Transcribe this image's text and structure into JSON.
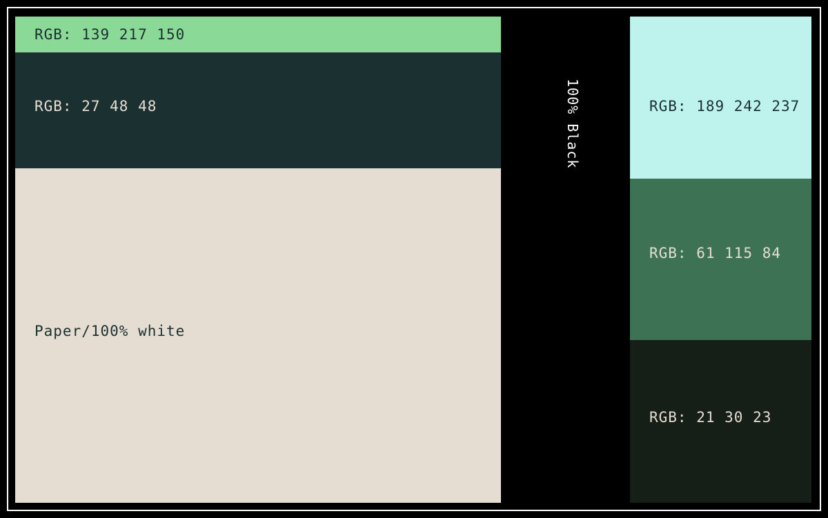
{
  "swatches": {
    "light_green": {
      "label": "RGB: 139 217 150",
      "color": "#8bd996"
    },
    "dark_teal": {
      "label": "RGB: 27 48 48",
      "color": "#1b3030"
    },
    "paper": {
      "label": "Paper/100% white",
      "color": "#e6ddd2"
    },
    "black": {
      "label": "100% Black",
      "color": "#000000"
    },
    "mint": {
      "label": "RGB: 189 242 237",
      "color": "#bdf2ed"
    },
    "forest": {
      "label": "RGB: 61 115 84",
      "color": "#3d7354"
    },
    "dark_green": {
      "label": "RGB: 21 30 23",
      "color": "#151e17"
    }
  }
}
